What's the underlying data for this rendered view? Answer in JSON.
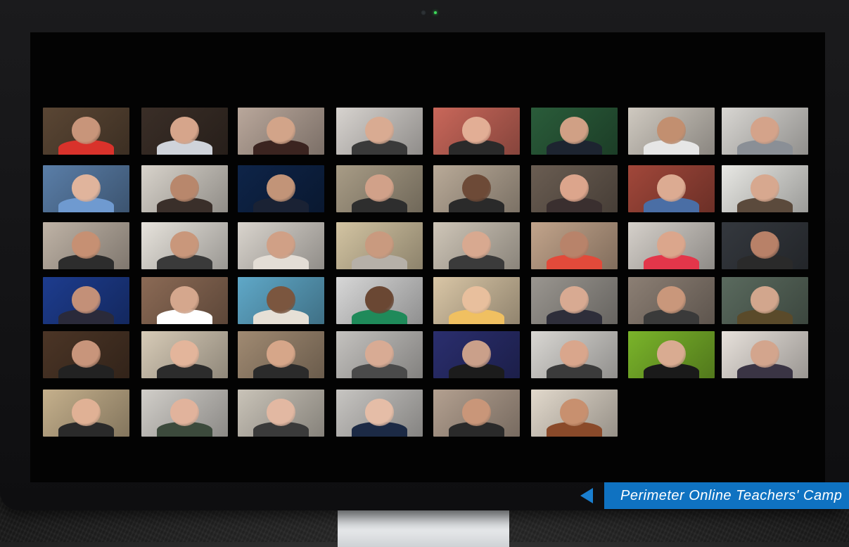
{
  "caption": {
    "text": "Perimeter Online Teachers' Camp"
  },
  "colors": {
    "accent": "#0f72c1",
    "screen_bg": "#030303"
  },
  "grid": {
    "rows": 6,
    "columns": 8,
    "participant_count": 46
  },
  "participants": [
    {
      "bg": "#5a4634",
      "skin": "#c8957a",
      "shirt": "#d9322b"
    },
    {
      "bg": "#3a2e27",
      "skin": "#d6a58b",
      "shirt": "#cfd3da"
    },
    {
      "bg": "#b9a79b",
      "skin": "#d2a489",
      "shirt": "#3b2420"
    },
    {
      "bg": "#d7d3cf",
      "skin": "#d9ab92",
      "shirt": "#3a3a3a"
    },
    {
      "bg": "#c9675a",
      "skin": "#e2ae95",
      "shirt": "#2a2a2a"
    },
    {
      "bg": "#2a5c3a",
      "skin": "#d0a085",
      "shirt": "#1d2430"
    },
    {
      "bg": "#cfc9c0",
      "skin": "#c28f70",
      "shirt": "#e6e6e6"
    },
    {
      "bg": "#d8d6d2",
      "skin": "#d4a38a",
      "shirt": "#8a8f96"
    },
    {
      "bg": "#5a7ea8",
      "skin": "#e0b49c",
      "shirt": "#6f9ad0"
    },
    {
      "bg": "#d8d3cb",
      "skin": "#b8876c",
      "shirt": "#3a2f2a"
    },
    {
      "bg": "#0e2448",
      "skin": "#c29478",
      "shirt": "#1a2234"
    },
    {
      "bg": "#a89c86",
      "skin": "#d1a189",
      "shirt": "#2e2e2e"
    },
    {
      "bg": "#b9aa98",
      "skin": "#6d4a37",
      "shirt": "#2a2a2a"
    },
    {
      "bg": "#6a5d52",
      "skin": "#dca58c",
      "shirt": "#3a2f2f"
    },
    {
      "bg": "#a1473a",
      "skin": "#dcab92",
      "shirt": "#4a6ea5"
    },
    {
      "bg": "#e8e8e4",
      "skin": "#d7a88f",
      "shirt": "#5b4a3c"
    },
    {
      "bg": "#bfb3a6",
      "skin": "#c69073",
      "shirt": "#2d2d2d"
    },
    {
      "bg": "#e7e3dc",
      "skin": "#c9977b",
      "shirt": "#3a3a3a"
    },
    {
      "bg": "#d9d4cd",
      "skin": "#d0a086",
      "shirt": "#e3ddd5"
    },
    {
      "bg": "#d3c4a2",
      "skin": "#c99a7f",
      "shirt": "#b6b0a8"
    },
    {
      "bg": "#cfc6b8",
      "skin": "#d8a990",
      "shirt": "#3b3b3b"
    },
    {
      "bg": "#c2a48b",
      "skin": "#b8836a",
      "shirt": "#e24a3a"
    },
    {
      "bg": "#d5d0ca",
      "skin": "#dba68c",
      "shirt": "#e3364a"
    },
    {
      "bg": "#34383e",
      "skin": "#b88168",
      "shirt": "#2a2a2a"
    },
    {
      "bg": "#1d3c8e",
      "skin": "#c39078",
      "shirt": "#2a2a3a"
    },
    {
      "bg": "#8b6a55",
      "skin": "#d5a78d",
      "shirt": "#ffffff"
    },
    {
      "bg": "#5fa8c8",
      "skin": "#7b563f",
      "shirt": "#e6e0d6"
    },
    {
      "bg": "#d7d7d7",
      "skin": "#6a4733",
      "shirt": "#1f8a5a"
    },
    {
      "bg": "#d9c6a6",
      "skin": "#e8bf9d",
      "shirt": "#f0c061"
    },
    {
      "bg": "#9a9690",
      "skin": "#d8aa92",
      "shirt": "#2e2e3a"
    },
    {
      "bg": "#8c7f74",
      "skin": "#c9977b",
      "shirt": "#3a3a3a"
    },
    {
      "bg": "#5a6a5e",
      "skin": "#d2a68d",
      "shirt": "#5a4a2a"
    },
    {
      "bg": "#4b3526",
      "skin": "#c8957b",
      "shirt": "#222222"
    },
    {
      "bg": "#d7cbb7",
      "skin": "#e3b59b",
      "shirt": "#2c2c2c"
    },
    {
      "bg": "#a08a72",
      "skin": "#d6a689",
      "shirt": "#2b2b2b"
    },
    {
      "bg": "#c4c2bf",
      "skin": "#d8ab94",
      "shirt": "#4a4a4a"
    },
    {
      "bg": "#2a2e6e",
      "skin": "#caa08a",
      "shirt": "#1c1c1c"
    },
    {
      "bg": "#d9d7d3",
      "skin": "#d9a68c",
      "shirt": "#3b3b3b"
    },
    {
      "bg": "#7ab42a",
      "skin": "#d9ab91",
      "shirt": "#1a1a1a"
    },
    {
      "bg": "#e7e1db",
      "skin": "#d3a58d",
      "shirt": "#3a3444"
    },
    {
      "bg": "#c5b08c",
      "skin": "#e0b195",
      "shirt": "#2a2a2a"
    },
    {
      "bg": "#d1cec9",
      "skin": "#e1b39c",
      "shirt": "#3c4a3c"
    },
    {
      "bg": "#c9c3b8",
      "skin": "#e2b8a2",
      "shirt": "#3a3a3a"
    },
    {
      "bg": "#c7c5c2",
      "skin": "#e5bda7",
      "shirt": "#1c2a45"
    },
    {
      "bg": "#b3a090",
      "skin": "#c99679",
      "shirt": "#2a2a2a"
    },
    {
      "bg": "#e2d9cc",
      "skin": "#c8906f",
      "shirt": "#8a4a2a"
    }
  ]
}
